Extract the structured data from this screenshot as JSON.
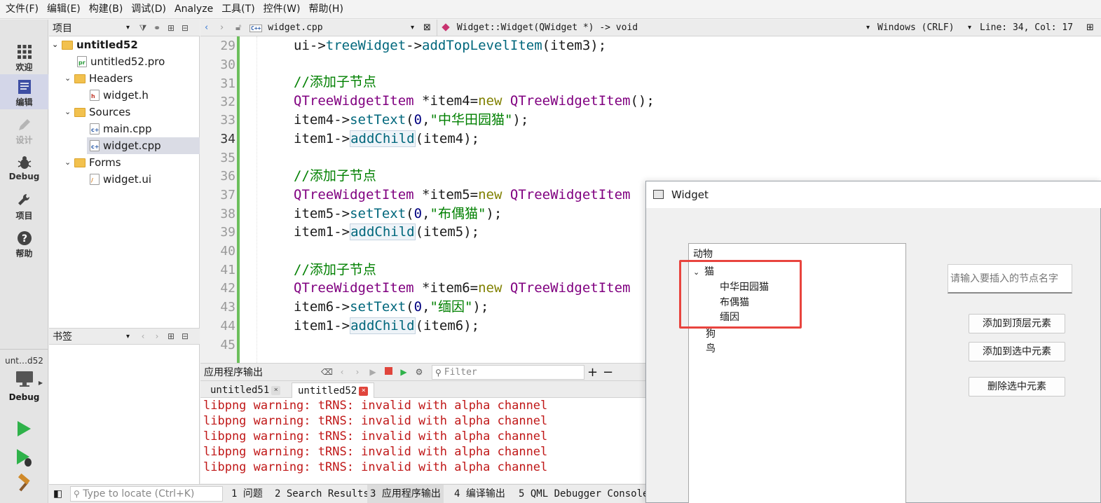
{
  "menubar": [
    "文件(F)",
    "编辑(E)",
    "构建(B)",
    "调试(D)",
    "Analyze",
    "工具(T)",
    "控件(W)",
    "帮助(H)"
  ],
  "modes": {
    "welcome": "欢迎",
    "edit": "编辑",
    "design": "设计",
    "debug": "Debug",
    "projects": "项目",
    "help": "帮助"
  },
  "kit": {
    "name": "unt…d52",
    "mode": "Debug"
  },
  "project_panel": {
    "title": "项目",
    "tree": [
      {
        "label": "untitled52",
        "icon": "project-folder"
      },
      {
        "label": "untitled52.pro",
        "icon": "pro-file"
      },
      {
        "label": "Headers",
        "icon": "folder"
      },
      {
        "label": "widget.h",
        "icon": "header-file"
      },
      {
        "label": "Sources",
        "icon": "folder"
      },
      {
        "label": "main.cpp",
        "icon": "cpp-file"
      },
      {
        "label": "widget.cpp",
        "icon": "cpp-file"
      },
      {
        "label": "Forms",
        "icon": "folder"
      },
      {
        "label": "widget.ui",
        "icon": "ui-file"
      }
    ]
  },
  "bookmark_panel": {
    "title": "书签"
  },
  "editor_toolbar": {
    "file": "widget.cpp",
    "symbol": "Widget::Widget(QWidget *) -> void",
    "line_ending": "Windows (CRLF)",
    "position": "Line: 34, Col: 17"
  },
  "code": {
    "lines": [
      "29",
      "30",
      "31",
      "32",
      "33",
      "34",
      "35",
      "36",
      "37",
      "38",
      "39",
      "40",
      "41",
      "42",
      "43",
      "44",
      "45"
    ],
    "l29": {
      "a": "ui->",
      "b": "treeWidget",
      "c": "->",
      "d": "addTopLevelItem",
      "e": "(item3);"
    },
    "l31": "//添加子节点",
    "l32": {
      "t1": "QTreeWidgetItem",
      "v": " *item4=",
      "kw": "new",
      "t2": " QTreeWidgetItem",
      "e": "();"
    },
    "l33": {
      "a": "item4->",
      "f": "setText",
      "p": "(",
      "n": "0",
      "c": ",",
      "s": "\"中华田园猫\"",
      "e": ");"
    },
    "l34": {
      "a": "item1->",
      "f": "addChild",
      "e": "(item4);"
    },
    "l36": "//添加子节点",
    "l37": {
      "t1": "QTreeWidgetItem",
      "v": " *item5=",
      "kw": "new",
      "t2": " QTreeWidgetItem"
    },
    "l38": {
      "a": "item5->",
      "f": "setText",
      "p": "(",
      "n": "0",
      "c": ",",
      "s": "\"布偶猫\"",
      "e": ");"
    },
    "l39": {
      "a": "item1->",
      "f": "addChild",
      "e": "(item5);"
    },
    "l41": "//添加子节点",
    "l42": {
      "t1": "QTreeWidgetItem",
      "v": " *item6=",
      "kw": "new",
      "t2": " QTreeWidgetItem"
    },
    "l43": {
      "a": "item6->",
      "f": "setText",
      "p": "(",
      "n": "0",
      "c": ",",
      "s": "\"缅因\"",
      "e": ");"
    },
    "l44": {
      "a": "item1->",
      "f": "addChild",
      "e": "(item6);"
    }
  },
  "output": {
    "title": "应用程序输出",
    "filter_placeholder": "Filter",
    "tabs": [
      "untitled51",
      "untitled52"
    ],
    "lines": [
      "libpng warning: tRNS: invalid with alpha channel",
      "libpng warning: tRNS: invalid with alpha channel",
      "libpng warning: tRNS: invalid with alpha channel",
      "libpng warning: tRNS: invalid with alpha channel",
      "libpng warning: tRNS: invalid with alpha channel"
    ]
  },
  "statusbar": {
    "locate_placeholder": "Type to locate (Ctrl+K)",
    "panes": [
      "1 问题",
      "2 Search Results",
      "3 应用程序输出",
      "4 编译输出",
      "5 QML Debugger Console"
    ]
  },
  "widget_window": {
    "title": "Widget",
    "tree": {
      "root": "动物",
      "cat": "猫",
      "children": [
        "中华田园猫",
        "布偶猫",
        "缅因"
      ],
      "dog": "狗",
      "bird": "鸟"
    },
    "input_placeholder": "请输入要插入的节点名字",
    "buttons": {
      "add_top": "添加到顶层元素",
      "add_selected": "添加到选中元素",
      "delete_selected": "删除选中元素"
    }
  },
  "colors": {
    "highlight": "#e8443e",
    "run": "#2fb24a",
    "stop": "#e0453c"
  }
}
